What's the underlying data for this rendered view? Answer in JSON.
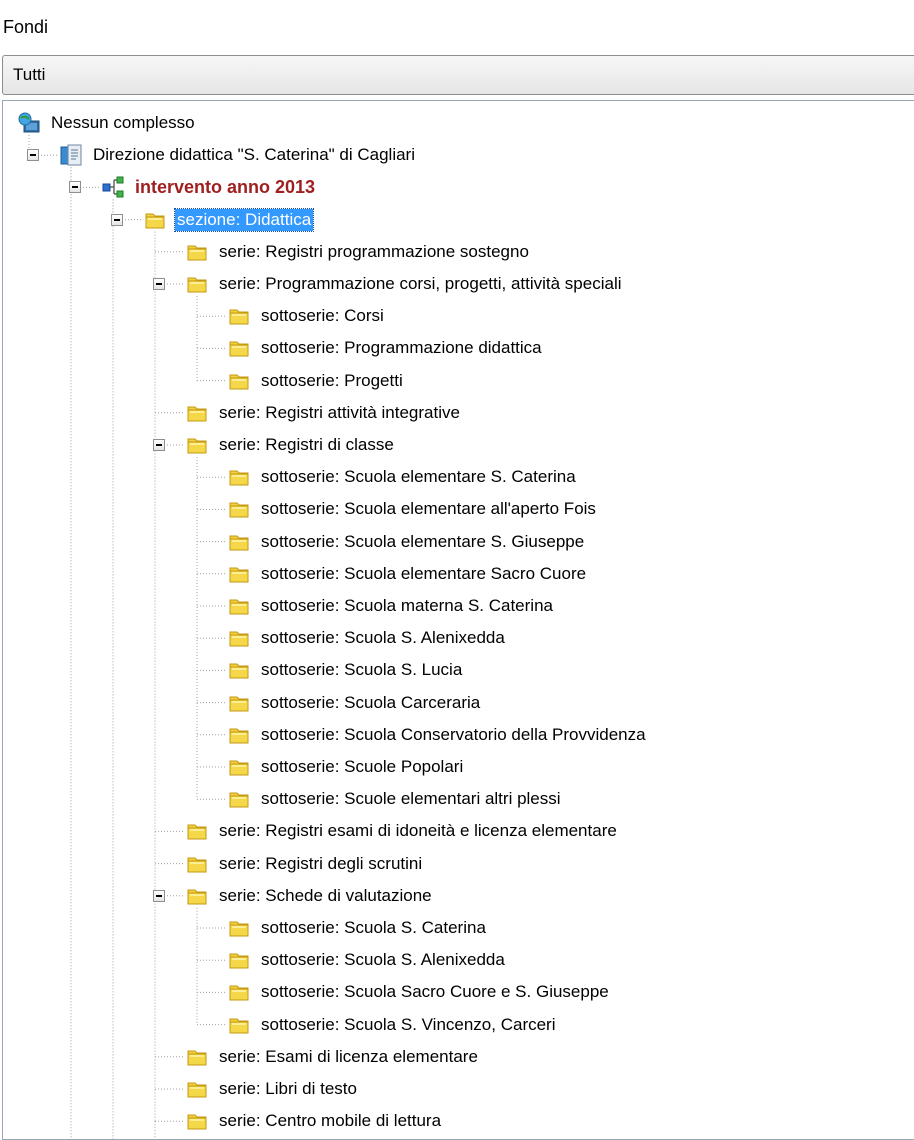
{
  "window": {
    "title": "Fondi"
  },
  "filter": {
    "value": "Tutti"
  },
  "tree": {
    "nodes": [
      {
        "label": "Nessun complesso",
        "level": 0,
        "icon": "globe-folder-icon"
      },
      {
        "label": "Direzione didattica \"S. Caterina\" di Cagliari",
        "level": 1,
        "icon": "fond-document-icon",
        "expanded": true
      },
      {
        "label": "intervento anno 2013",
        "level": 2,
        "icon": "network-tree-icon",
        "expanded": true,
        "style": "intervento"
      },
      {
        "label": "sezione: Didattica",
        "level": 3,
        "icon": "folder-icon",
        "expanded": true,
        "selected": true
      },
      {
        "label": "serie: Registri programmazione sostegno",
        "level": 4,
        "icon": "folder-icon"
      },
      {
        "label": "serie: Programmazione corsi, progetti, attività speciali",
        "level": 4,
        "icon": "folder-icon",
        "expanded": true
      },
      {
        "label": "sottoserie: Corsi",
        "level": 5,
        "icon": "folder-icon"
      },
      {
        "label": "sottoserie: Programmazione didattica",
        "level": 5,
        "icon": "folder-icon"
      },
      {
        "label": "sottoserie: Progetti",
        "level": 5,
        "icon": "folder-icon"
      },
      {
        "label": "serie: Registri attività integrative",
        "level": 4,
        "icon": "folder-icon"
      },
      {
        "label": "serie: Registri di classe",
        "level": 4,
        "icon": "folder-icon",
        "expanded": true
      },
      {
        "label": "sottoserie: Scuola elementare S. Caterina",
        "level": 5,
        "icon": "folder-icon"
      },
      {
        "label": "sottoserie: Scuola elementare all'aperto Fois",
        "level": 5,
        "icon": "folder-icon"
      },
      {
        "label": "sottoserie: Scuola elementare S. Giuseppe",
        "level": 5,
        "icon": "folder-icon"
      },
      {
        "label": "sottoserie: Scuola elementare Sacro Cuore",
        "level": 5,
        "icon": "folder-icon"
      },
      {
        "label": "sottoserie: Scuola materna S. Caterina",
        "level": 5,
        "icon": "folder-icon"
      },
      {
        "label": "sottoserie: Scuola S. Alenixedda",
        "level": 5,
        "icon": "folder-icon"
      },
      {
        "label": "sottoserie: Scuola S. Lucia",
        "level": 5,
        "icon": "folder-icon"
      },
      {
        "label": "sottoserie: Scuola Carceraria",
        "level": 5,
        "icon": "folder-icon"
      },
      {
        "label": "sottoserie: Scuola Conservatorio della Provvidenza",
        "level": 5,
        "icon": "folder-icon"
      },
      {
        "label": "sottoserie: Scuole Popolari",
        "level": 5,
        "icon": "folder-icon"
      },
      {
        "label": "sottoserie: Scuole elementari altri plessi",
        "level": 5,
        "icon": "folder-icon"
      },
      {
        "label": "serie: Registri esami di idoneità e licenza elementare",
        "level": 4,
        "icon": "folder-icon"
      },
      {
        "label": "serie: Registri degli scrutini",
        "level": 4,
        "icon": "folder-icon"
      },
      {
        "label": "serie: Schede di valutazione",
        "level": 4,
        "icon": "folder-icon",
        "expanded": true
      },
      {
        "label": "sottoserie: Scuola S. Caterina",
        "level": 5,
        "icon": "folder-icon"
      },
      {
        "label": "sottoserie: Scuola S. Alenixedda",
        "level": 5,
        "icon": "folder-icon"
      },
      {
        "label": "sottoserie: Scuola Sacro Cuore e S. Giuseppe",
        "level": 5,
        "icon": "folder-icon"
      },
      {
        "label": "sottoserie: Scuola S. Vincenzo, Carceri",
        "level": 5,
        "icon": "folder-icon"
      },
      {
        "label": "serie: Esami di licenza elementare",
        "level": 4,
        "icon": "folder-icon"
      },
      {
        "label": "serie: Libri di testo",
        "level": 4,
        "icon": "folder-icon"
      },
      {
        "label": "serie: Centro mobile di lettura",
        "level": 4,
        "icon": "folder-icon"
      }
    ]
  },
  "colors": {
    "selection": "#3399ff",
    "intervento_text": "#a02020",
    "folder": "#f5d74a",
    "border": "#9aa6b5"
  }
}
